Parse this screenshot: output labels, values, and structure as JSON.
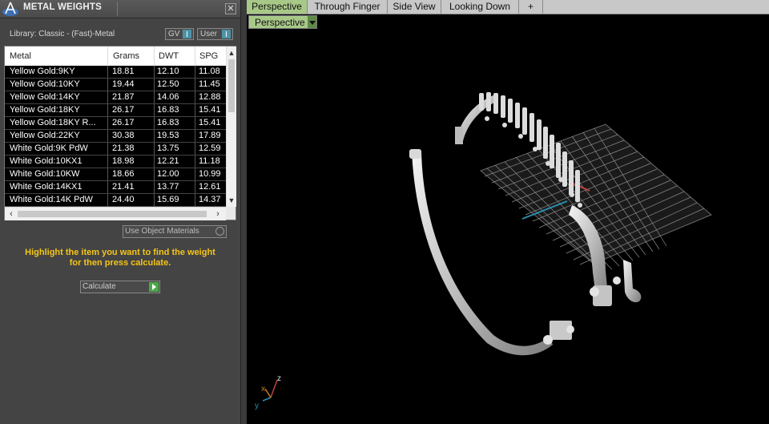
{
  "panel": {
    "title": "METAL WEIGHTS",
    "close_label": "✕",
    "library_label": "Library: Classic - (Fast)-Metal",
    "gv_label": "GV",
    "user_label": "User",
    "use_object_materials_label": "Use Object Materials",
    "instructions_line1": "Highlight the item you want to find the weight",
    "instructions_line2": "for then press calculate.",
    "calculate_label": "Calculate"
  },
  "table": {
    "headers": [
      "Metal",
      "Grams",
      "DWT",
      "SPG"
    ],
    "rows": [
      [
        "Yellow Gold:9KY",
        "18.81",
        "12.10",
        "11.08"
      ],
      [
        "Yellow Gold:10KY",
        "19.44",
        "12.50",
        "11.45"
      ],
      [
        "Yellow Gold:14KY",
        "21.87",
        "14.06",
        "12.88"
      ],
      [
        "Yellow Gold:18KY",
        "26.17",
        "16.83",
        "15.41"
      ],
      [
        "Yellow Gold:18KY R...",
        "26.17",
        "16.83",
        "15.41"
      ],
      [
        "Yellow Gold:22KY",
        "30.38",
        "19.53",
        "17.89"
      ],
      [
        "White Gold:9K PdW",
        "21.38",
        "13.75",
        "12.59"
      ],
      [
        "White Gold:10KX1",
        "18.98",
        "12.21",
        "11.18"
      ],
      [
        "White Gold:10KW",
        "18.66",
        "12.00",
        "10.99"
      ],
      [
        "White Gold:14KX1",
        "21.41",
        "13.77",
        "12.61"
      ],
      [
        "White Gold:14K PdW",
        "24.40",
        "15.69",
        "14.37"
      ]
    ]
  },
  "viewport": {
    "tabs": [
      "Perspective",
      "Through Finger",
      "Side View",
      "Looking Down",
      "+"
    ],
    "active_tab": "Perspective",
    "view_dropdown": "Perspective",
    "axis_labels": {
      "x": "x",
      "y": "y",
      "z": "z"
    }
  },
  "colors": {
    "accent_green": "#a8c888",
    "instruction_yellow": "#f5c518",
    "go_green": "#4aa84a"
  }
}
